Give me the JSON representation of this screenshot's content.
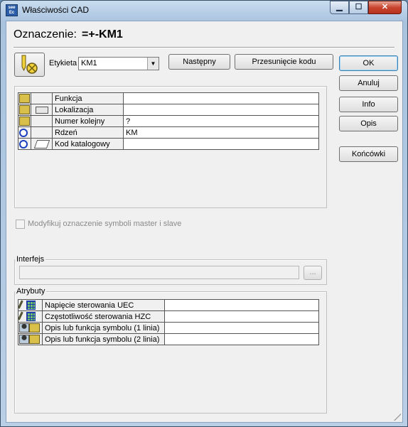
{
  "window": {
    "title": "Właściwości CAD",
    "app_icon": "see-app-icon"
  },
  "header": {
    "label": "Oznaczenie:",
    "value": "=+-KM1"
  },
  "tag": {
    "label": "Etykieta",
    "value": "KM1"
  },
  "buttons": {
    "next": "Następny",
    "shift_code": "Przesunięcie kodu",
    "ok": "OK",
    "cancel": "Anuluj",
    "info": "Info",
    "description": "Opis",
    "terminals": "Końcówki",
    "browse": "..."
  },
  "properties": [
    {
      "icon": "symbol-icon",
      "sub_icon": "",
      "name": "Funkcja",
      "value": ""
    },
    {
      "icon": "symbol-icon",
      "sub_icon": "device-icon",
      "name": "Lokalizacja",
      "value": ""
    },
    {
      "icon": "symbol-icon",
      "sub_icon": "",
      "name": "Numer kolejny",
      "value": "?"
    },
    {
      "icon": "circle-icon",
      "sub_icon": "",
      "name": "Rdzeń",
      "value": "KM"
    },
    {
      "icon": "circle-icon",
      "sub_icon": "book-icon",
      "name": "Kod katalogowy",
      "value": ""
    }
  ],
  "modify_checkbox": {
    "label": "Modyfikuj oznaczenie symboli master i slave",
    "checked": false
  },
  "interface": {
    "title": "Interfejs",
    "value": ""
  },
  "attributes": {
    "title": "Atrybuty",
    "rows": [
      {
        "icons": [
          "pen-icon",
          "table-icon"
        ],
        "name": "Napięcie sterowania UEC",
        "value": ""
      },
      {
        "icons": [
          "pen-icon",
          "table-icon"
        ],
        "name": "Częstotliwość sterowania HZC",
        "value": ""
      },
      {
        "icons": [
          "person-icon",
          "symbol-text-icon"
        ],
        "name": "Opis lub funkcja symbolu (1 linia)",
        "value": ""
      },
      {
        "icons": [
          "person-icon",
          "symbol-text-icon"
        ],
        "name": "Opis lub funkcja symbolu (2 linia)",
        "value": ""
      }
    ]
  }
}
